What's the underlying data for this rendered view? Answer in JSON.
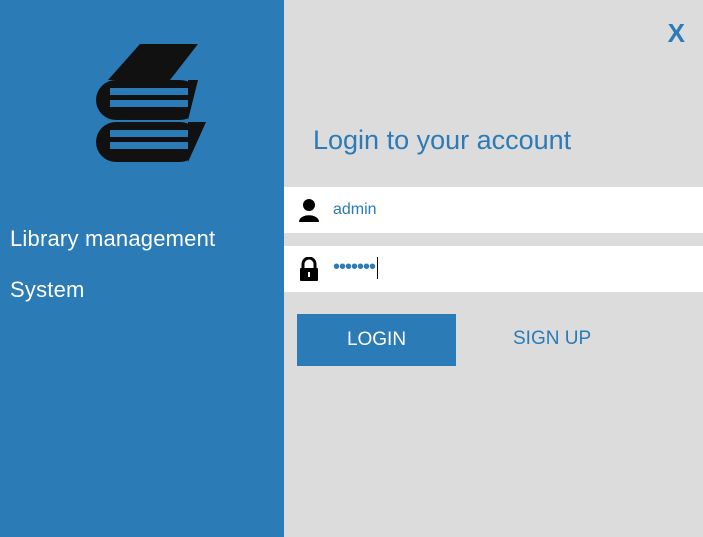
{
  "sidebar": {
    "logo_icon": "books-icon",
    "app_name_line1": "Library management",
    "app_name_line2": "System"
  },
  "header": {
    "close_label": "X"
  },
  "form": {
    "title": "Login to your account",
    "username": {
      "icon": "user-icon",
      "value": "admin"
    },
    "password": {
      "icon": "lock-icon",
      "value": "•••••••"
    },
    "login_label": "LOGIN",
    "signup_label": "SIGN UP"
  },
  "colors": {
    "accent": "#2a7bb6",
    "panel_bg": "#dcdcdc",
    "field_bg": "#ffffff"
  }
}
